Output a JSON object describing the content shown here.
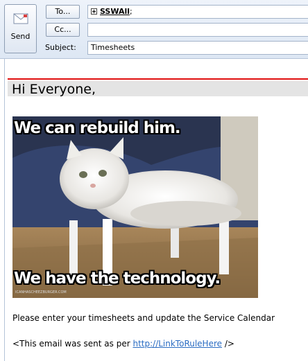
{
  "compose": {
    "send_label": "Send",
    "to_label": "To...",
    "cc_label": "Cc...",
    "subject_label": "Subject:",
    "to_value": "SSWAll",
    "to_separator": ";",
    "cc_value": "",
    "subject_value": "Timesheets"
  },
  "message": {
    "greeting": "Hi Everyone,",
    "meme_top": "We can rebuild him.",
    "meme_bottom": "We have the technology.",
    "meme_credit": "ICANHASCHEEZBURGER.COM",
    "line1": "Please enter your timesheets and update the Service Calendar",
    "line2_prefix": "<This email was sent as per ",
    "line2_link": "http://LinkToRuleHere",
    "line2_suffix": " />"
  },
  "colors": {
    "accent_red": "#e01010",
    "link_blue": "#2a6cc2"
  }
}
